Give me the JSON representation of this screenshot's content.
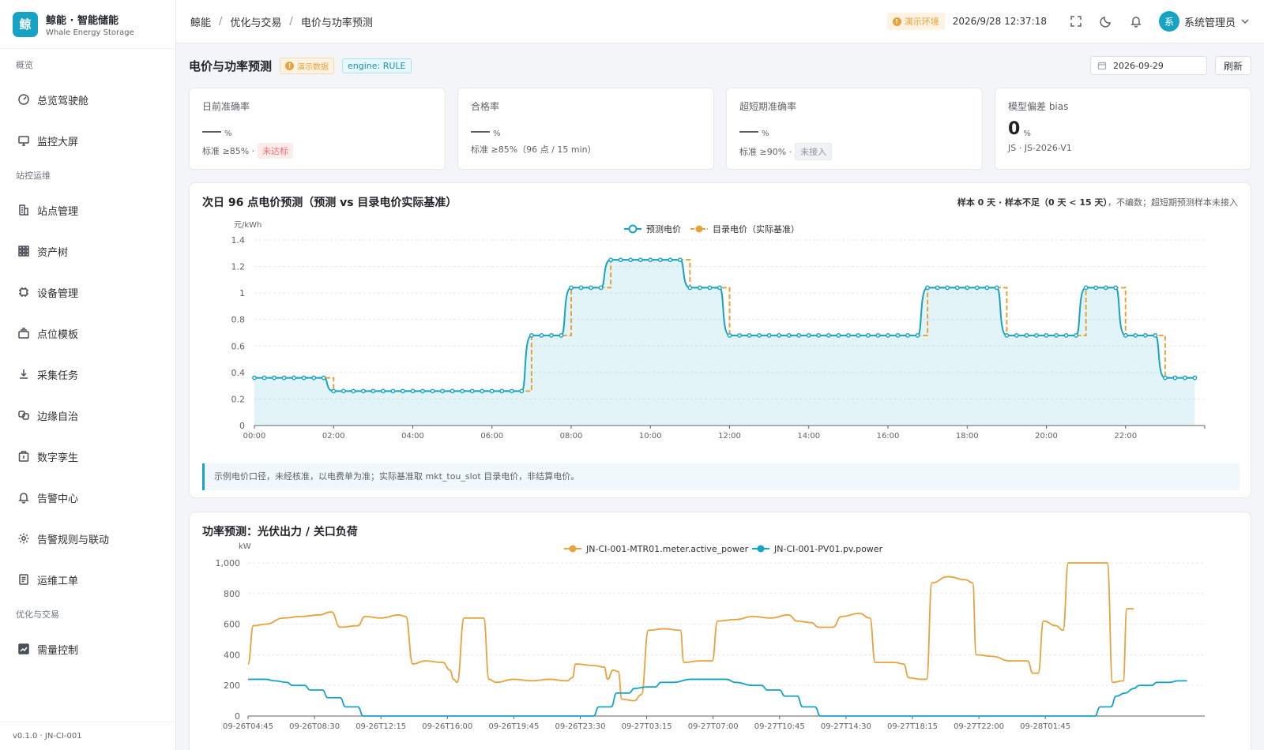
{
  "brand": {
    "logo_char": "鲸",
    "title": "鲸能 · 智能储能",
    "subtitle": "Whale Energy Storage"
  },
  "sidebar": {
    "groups": [
      {
        "label": "概览",
        "items": [
          {
            "label": "总览驾驶舱",
            "icon": "dashboard-icon"
          },
          {
            "label": "监控大屏",
            "icon": "monitor-icon"
          }
        ]
      },
      {
        "label": "站控运维",
        "items": [
          {
            "label": "站点管理",
            "icon": "building-icon"
          },
          {
            "label": "资产树",
            "icon": "grid-icon"
          },
          {
            "label": "设备管理",
            "icon": "chip-icon"
          },
          {
            "label": "点位模板",
            "icon": "layers-icon"
          },
          {
            "label": "采集任务",
            "icon": "download-icon"
          },
          {
            "label": "边缘自治",
            "icon": "link-icon"
          },
          {
            "label": "数字孪生",
            "icon": "cube-icon"
          },
          {
            "label": "告警中心",
            "icon": "bell-icon"
          },
          {
            "label": "告警规则与联动",
            "icon": "gear-icon"
          },
          {
            "label": "运维工单",
            "icon": "document-icon"
          }
        ]
      },
      {
        "label": "优化与交易",
        "items": [
          {
            "label": "需量控制",
            "icon": "chart-icon"
          }
        ]
      }
    ],
    "footer": "v0.1.0 · JN-CI-001"
  },
  "topbar": {
    "breadcrumbs": [
      "鲸能",
      "优化与交易",
      "电价与功率预测"
    ],
    "env_badge": "演示环境",
    "datetime": "2026/9/28 12:37:18",
    "user_avatar": "系",
    "user_name": "系统管理员"
  },
  "page": {
    "title": "电价与功率预测",
    "demo_tag": "演示数据",
    "engine_tag": "engine: RULE",
    "date_value": "2026-09-29",
    "refresh_label": "刷新"
  },
  "stats": [
    {
      "title": "日前准确率",
      "value": "",
      "unit": "%",
      "foot": "标准 ≥85% ·",
      "badge": "未达标",
      "badge_type": "red"
    },
    {
      "title": "合格率",
      "value": "",
      "unit": "%",
      "foot": "标准 ≥85%（96 点 / 15 min）",
      "badge": "",
      "badge_type": ""
    },
    {
      "title": "超短期准确率",
      "value": "",
      "unit": "%",
      "foot": "标准 ≥90% ·",
      "badge": "未接入",
      "badge_type": "gray"
    },
    {
      "title": "模型偏差 bias",
      "value": "0",
      "unit": "%",
      "foot": "JS · JS-2026-V1",
      "badge": "",
      "badge_type": ""
    }
  ],
  "price_panel": {
    "title": "次日 96 点电价预测（预测 vs 目录电价实际基准）",
    "meta_prefix": "样本 0 天 · 样本不足（0 天 < 15 天）",
    "meta_suffix": "，不编数；超短期预测样本未接入",
    "note": "示例电价口径，未经核准，以电费单为准；实际基准取 mkt_tou_slot 目录电价，非结算电价。"
  },
  "power_panel": {
    "title": "功率预测：光伏出力 / 关口负荷"
  },
  "chart_data": [
    {
      "type": "line",
      "ylabel": "元/kWh",
      "ylim": [
        0,
        1.4
      ],
      "yticks": [
        0,
        0.2,
        0.4,
        0.6,
        0.8,
        1,
        1.2,
        1.4
      ],
      "xticks": [
        "00:00",
        "02:00",
        "04:00",
        "06:00",
        "08:00",
        "10:00",
        "12:00",
        "14:00",
        "16:00",
        "18:00",
        "20:00",
        "22:00"
      ],
      "x_unit": "hour",
      "step_interval_hours": 0.25,
      "series": [
        {
          "name": "预测电价",
          "color": "#16a3c4",
          "shape": "step-smooth-with-markers",
          "segments": [
            {
              "from": 0,
              "to": 2,
              "value": 0.36
            },
            {
              "from": 2,
              "to": 7,
              "value": 0.26
            },
            {
              "from": 7,
              "to": 8,
              "value": 0.68
            },
            {
              "from": 8,
              "to": 9,
              "value": 1.04
            },
            {
              "from": 9,
              "to": 11,
              "value": 1.25
            },
            {
              "from": 11,
              "to": 12,
              "value": 1.04
            },
            {
              "from": 12,
              "to": 17,
              "value": 0.68
            },
            {
              "from": 17,
              "to": 19,
              "value": 1.04
            },
            {
              "from": 19,
              "to": 21,
              "value": 0.68
            },
            {
              "from": 21,
              "to": 22,
              "value": 1.04
            },
            {
              "from": 22,
              "to": 23,
              "value": 0.68
            },
            {
              "from": 23,
              "to": 23.75,
              "value": 0.36
            }
          ]
        },
        {
          "name": "目录电价（实际基准）",
          "color": "#e6a23c",
          "shape": "step-dashed",
          "segments": [
            {
              "from": 0,
              "to": 2,
              "value": 0.36
            },
            {
              "from": 2,
              "to": 7,
              "value": 0.26
            },
            {
              "from": 7,
              "to": 8,
              "value": 0.68
            },
            {
              "from": 8,
              "to": 9,
              "value": 1.04
            },
            {
              "from": 9,
              "to": 11,
              "value": 1.25
            },
            {
              "from": 11,
              "to": 12,
              "value": 1.04
            },
            {
              "from": 12,
              "to": 17,
              "value": 0.68
            },
            {
              "from": 17,
              "to": 19,
              "value": 1.04
            },
            {
              "from": 19,
              "to": 21,
              "value": 0.68
            },
            {
              "from": 21,
              "to": 22,
              "value": 1.04
            },
            {
              "from": 22,
              "to": 23,
              "value": 0.68
            },
            {
              "from": 23,
              "to": 23.75,
              "value": 0.36
            }
          ]
        }
      ],
      "legend_position": "top-center",
      "grid": true
    },
    {
      "type": "line",
      "ylabel": "kW",
      "ylim": [
        0,
        1000
      ],
      "yticks": [
        0,
        200,
        400,
        600,
        800,
        1000
      ],
      "ytick_labels": [
        "0",
        "200",
        "400",
        "600",
        "800",
        "1,000"
      ],
      "xticks": [
        "09-26T04:45",
        "09-26T08:30",
        "09-26T12:15",
        "09-26T16:00",
        "09-26T19:45",
        "09-26T23:30",
        "09-27T03:15",
        "09-27T07:00",
        "09-27T10:45",
        "09-27T14:30",
        "09-27T18:15",
        "09-27T22:00",
        "09-28T01:45"
      ],
      "xlim_hours_from_0445": [
        0,
        48
      ],
      "series": [
        {
          "name": "JN-CI-001-MTR01.meter.active_power",
          "color": "#e6a23c",
          "points": [
            [
              0,
              340
            ],
            [
              0.3,
              590
            ],
            [
              1,
              600
            ],
            [
              2,
              640
            ],
            [
              3,
              650
            ],
            [
              4,
              660
            ],
            [
              4.7,
              680
            ],
            [
              5.2,
              580
            ],
            [
              6.2,
              590
            ],
            [
              6.6,
              650
            ],
            [
              7.5,
              640
            ],
            [
              8.5,
              660
            ],
            [
              8.9,
              650
            ],
            [
              9.3,
              340
            ],
            [
              10,
              360
            ],
            [
              11,
              350
            ],
            [
              11.4,
              300
            ],
            [
              11.6,
              240
            ],
            [
              11.8,
              220
            ],
            [
              12.2,
              640
            ],
            [
              13.3,
              640
            ],
            [
              13.6,
              240
            ],
            [
              14,
              220
            ],
            [
              15,
              240
            ],
            [
              16,
              230
            ],
            [
              17,
              240
            ],
            [
              18,
              230
            ],
            [
              18.3,
              250
            ],
            [
              18.5,
              340
            ],
            [
              19.5,
              330
            ],
            [
              20.1,
              320
            ],
            [
              20.3,
              240
            ],
            [
              20.6,
              300
            ],
            [
              20.9,
              290
            ],
            [
              21.1,
              110
            ],
            [
              21.8,
              100
            ],
            [
              22.2,
              140
            ],
            [
              22.6,
              560
            ],
            [
              23.5,
              570
            ],
            [
              24.4,
              560
            ],
            [
              24.6,
              350
            ],
            [
              25.5,
              360
            ],
            [
              26.2,
              360
            ],
            [
              26.5,
              620
            ],
            [
              27.5,
              630
            ],
            [
              28.5,
              650
            ],
            [
              29.5,
              640
            ],
            [
              30.5,
              660
            ],
            [
              31,
              620
            ],
            [
              31.8,
              610
            ],
            [
              32.2,
              580
            ],
            [
              33,
              580
            ],
            [
              33.5,
              650
            ],
            [
              34.5,
              670
            ],
            [
              35.1,
              640
            ],
            [
              35.4,
              350
            ],
            [
              36.5,
              350
            ],
            [
              37,
              340
            ],
            [
              37.3,
              250
            ],
            [
              38,
              240
            ],
            [
              38.3,
              240
            ],
            [
              38.6,
              870
            ],
            [
              39.5,
              910
            ],
            [
              40.5,
              890
            ],
            [
              40.9,
              870
            ],
            [
              41.1,
              400
            ],
            [
              42,
              390
            ],
            [
              43,
              360
            ],
            [
              44,
              360
            ],
            [
              44.3,
              280
            ],
            [
              44.6,
              280
            ],
            [
              44.9,
              620
            ],
            [
              45.6,
              590
            ],
            [
              46,
              560
            ],
            [
              46.3,
              1000
            ],
            [
              48.5,
              1000
            ],
            [
              48.8,
              220
            ],
            [
              49.4,
              230
            ],
            [
              49.6,
              700
            ],
            [
              50,
              700
            ]
          ]
        },
        {
          "name": "JN-CI-001-PV01.pv.power",
          "color": "#16a3c4",
          "points": [
            [
              0,
              240
            ],
            [
              1,
              240
            ],
            [
              1.5,
              230
            ],
            [
              2.2,
              220
            ],
            [
              2.5,
              200
            ],
            [
              3.2,
              200
            ],
            [
              3.5,
              170
            ],
            [
              4.2,
              170
            ],
            [
              4.5,
              120
            ],
            [
              5.2,
              120
            ],
            [
              5.5,
              60
            ],
            [
              6.2,
              60
            ],
            [
              6.5,
              0
            ],
            [
              19,
              0
            ],
            [
              19.5,
              0
            ],
            [
              19.8,
              60
            ],
            [
              20.5,
              60
            ],
            [
              20.8,
              150
            ],
            [
              21.5,
              150
            ],
            [
              21.8,
              180
            ],
            [
              22.5,
              190
            ],
            [
              23,
              190
            ],
            [
              23.3,
              220
            ],
            [
              24,
              220
            ],
            [
              25,
              240
            ],
            [
              26,
              240
            ],
            [
              27,
              240
            ],
            [
              27.5,
              220
            ],
            [
              28.5,
              200
            ],
            [
              29,
              200
            ],
            [
              29.3,
              170
            ],
            [
              30,
              170
            ],
            [
              30.3,
              130
            ],
            [
              31,
              130
            ],
            [
              31.3,
              60
            ],
            [
              32,
              60
            ],
            [
              32.3,
              0
            ],
            [
              47.8,
              0
            ],
            [
              48.1,
              60
            ],
            [
              48.7,
              60
            ],
            [
              49,
              130
            ],
            [
              49.5,
              150
            ],
            [
              50,
              180
            ],
            [
              50.3,
              200
            ],
            [
              51,
              200
            ],
            [
              51.3,
              220
            ],
            [
              52,
              220
            ],
            [
              52.5,
              230
            ],
            [
              53,
              230
            ]
          ]
        }
      ],
      "legend_position": "top-center",
      "grid": true
    }
  ]
}
